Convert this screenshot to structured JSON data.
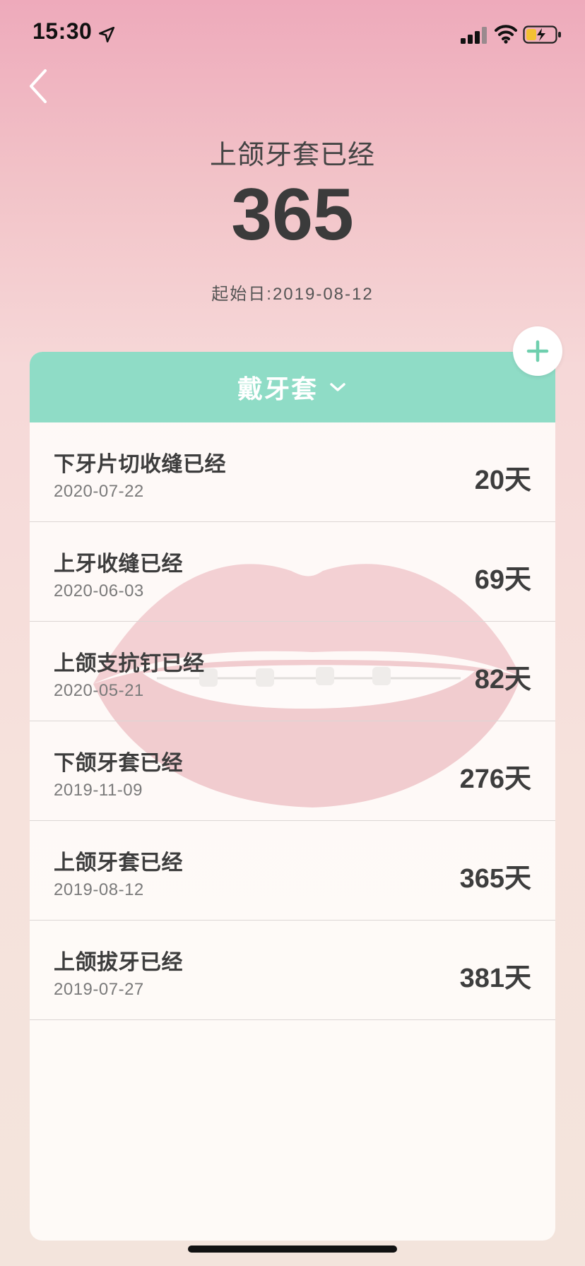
{
  "status_bar": {
    "time": "15:30",
    "location_icon": "location-arrow-icon",
    "signal_icon": "cellular-signal-icon",
    "wifi_icon": "wifi-icon",
    "battery_icon": "battery-charging-icon",
    "battery_color": "#f4c033"
  },
  "nav": {
    "back_icon": "chevron-left-icon"
  },
  "header": {
    "title": "上颌牙套已经",
    "count": "365",
    "start_label": "起始日:2019-08-12"
  },
  "category": {
    "label": "戴牙套",
    "dropdown_icon": "chevron-down-icon",
    "color": "#8fdcc6"
  },
  "add_icon": "plus-icon",
  "add_color": "#6fcfae",
  "items": [
    {
      "title": "下牙片切收缝已经",
      "date": "2020-07-22",
      "days": "20天"
    },
    {
      "title": "上牙收缝已经",
      "date": "2020-06-03",
      "days": "69天"
    },
    {
      "title": "上颌支抗钉已经",
      "date": "2020-05-21",
      "days": "82天"
    },
    {
      "title": "下颌牙套已经",
      "date": "2019-11-09",
      "days": "276天"
    },
    {
      "title": "上颌牙套已经",
      "date": "2019-08-12",
      "days": "365天"
    },
    {
      "title": "上颌拔牙已经",
      "date": "2019-07-27",
      "days": "381天"
    }
  ]
}
